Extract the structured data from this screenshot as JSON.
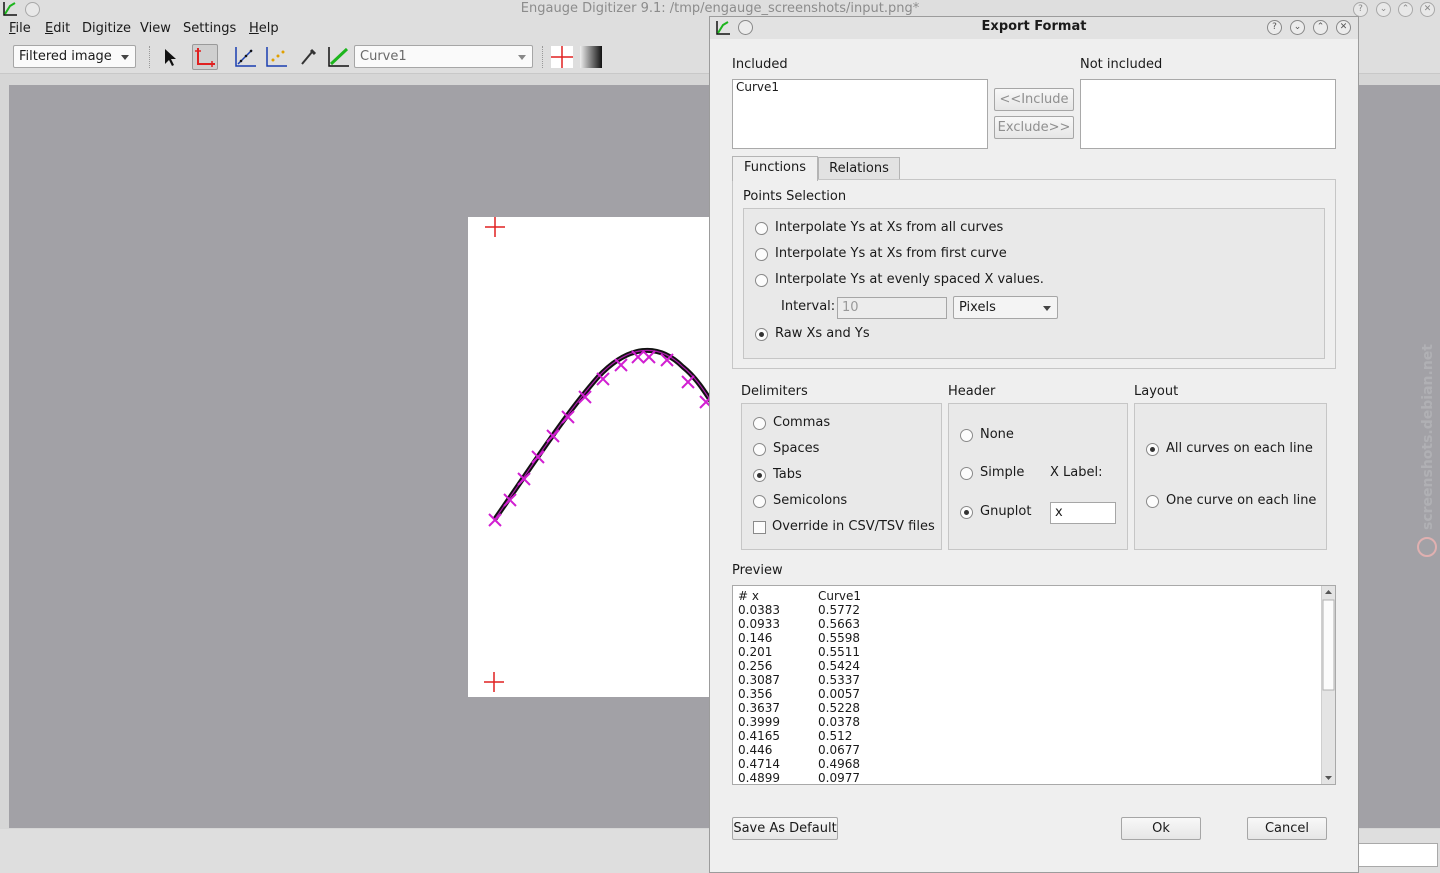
{
  "window": {
    "title": "Engauge Digitizer 9.1: /tmp/engauge_screenshots/input.png*"
  },
  "menubar": {
    "items": [
      {
        "label": "File"
      },
      {
        "label": "Edit"
      },
      {
        "label": "Digitize"
      },
      {
        "label": "View"
      },
      {
        "label": "Settings"
      },
      {
        "label": "Help"
      }
    ]
  },
  "toolbar": {
    "background_mode": "Filtered image",
    "curve_select": "Curve1"
  },
  "dialog": {
    "title": "Export Format",
    "included_label": "Included",
    "not_included_label": "Not included",
    "included_items": [
      "Curve1"
    ],
    "include_button": "<<Include",
    "exclude_button": "Exclude>>",
    "tabs": [
      {
        "label": "Functions",
        "active": true
      },
      {
        "label": "Relations",
        "active": false
      }
    ],
    "points_selection": {
      "label": "Points Selection",
      "options": [
        {
          "label": "Interpolate Ys at Xs from all curves",
          "selected": false
        },
        {
          "label": "Interpolate Ys at Xs from first curve",
          "selected": false
        },
        {
          "label": "Interpolate Ys at evenly spaced X values.",
          "selected": false
        }
      ],
      "interval_label": "Interval:",
      "interval_value": "10",
      "interval_units": "Pixels",
      "raw_option": {
        "label": "Raw Xs and Ys",
        "selected": true
      }
    },
    "delimiters": {
      "label": "Delimiters",
      "options": [
        {
          "label": "Commas",
          "selected": false
        },
        {
          "label": "Spaces",
          "selected": false
        },
        {
          "label": "Tabs",
          "selected": true
        },
        {
          "label": "Semicolons",
          "selected": false
        }
      ],
      "override_label": "Override in CSV/TSV files",
      "override_checked": false
    },
    "header": {
      "label": "Header",
      "options": [
        {
          "label": "None",
          "selected": false
        },
        {
          "label": "Simple",
          "selected": false
        },
        {
          "label": "Gnuplot",
          "selected": true
        }
      ],
      "x_label_caption": "X Label:",
      "x_label_value": "x"
    },
    "layout": {
      "label": "Layout",
      "options": [
        {
          "label": "All curves on each line",
          "selected": true
        },
        {
          "label": "One curve on each line",
          "selected": false
        }
      ]
    },
    "preview": {
      "label": "Preview",
      "header": [
        "# x",
        "Curve1"
      ],
      "rows": [
        [
          "0.0383",
          "0.5772"
        ],
        [
          "0.0933",
          "0.5663"
        ],
        [
          "0.146",
          "0.5598"
        ],
        [
          "0.201",
          "0.5511"
        ],
        [
          "0.256",
          "0.5424"
        ],
        [
          "0.3087",
          "0.5337"
        ],
        [
          "0.356",
          "0.0057"
        ],
        [
          "0.3637",
          "0.5228"
        ],
        [
          "0.3999",
          "0.0378"
        ],
        [
          "0.4165",
          "0.512"
        ],
        [
          "0.446",
          "0.0677"
        ],
        [
          "0.4714",
          "0.4968"
        ],
        [
          "0.4899",
          "0.0977"
        ]
      ]
    },
    "save_default_button": "Save As Default",
    "ok_button": "Ok",
    "cancel_button": "Cancel"
  },
  "watermark": "screenshots.debian.net",
  "colors": {
    "axis_marker": "#e02020",
    "curve_line": "#111111",
    "point_marker": "#d11fd1",
    "canvas_bg": "#a2a1a6"
  }
}
